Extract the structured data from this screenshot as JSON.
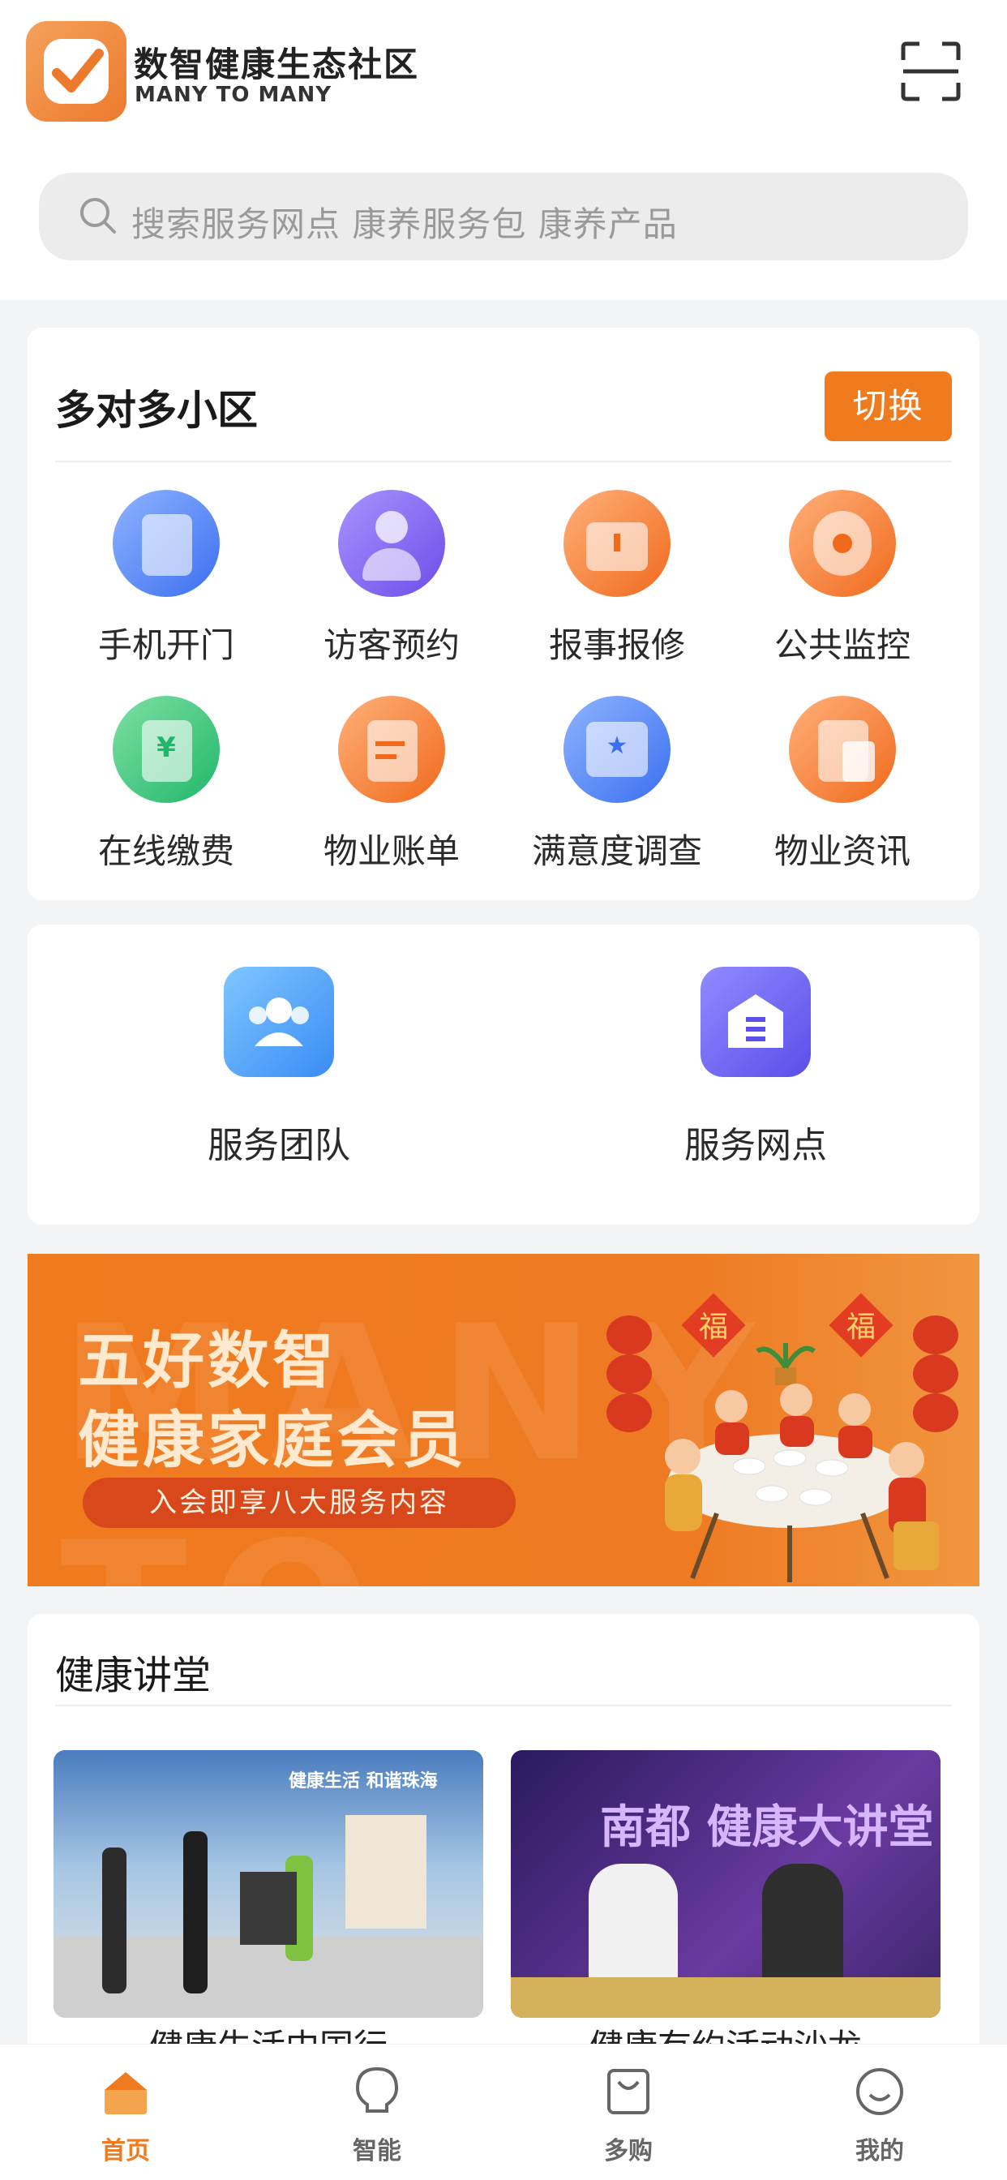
{
  "header": {
    "brand_cn": "数智健康生态社区",
    "brand_en": "MANY TO MANY"
  },
  "search": {
    "placeholder": "搜索服务网点 康养服务包 康养产品"
  },
  "community": {
    "title": "多对多小区",
    "switch_label": "切换",
    "items": [
      {
        "label": "手机开门",
        "icon": "door-icon",
        "color": "blue"
      },
      {
        "label": "访客预约",
        "icon": "visitor-icon",
        "color": "purple"
      },
      {
        "label": "报事报修",
        "icon": "toolbox-icon",
        "color": "orange"
      },
      {
        "label": "公共监控",
        "icon": "camera-icon",
        "color": "orange"
      },
      {
        "label": "在线缴费",
        "icon": "payment-icon",
        "color": "green"
      },
      {
        "label": "物业账单",
        "icon": "bill-icon",
        "color": "orange"
      },
      {
        "label": "满意度调查",
        "icon": "survey-icon",
        "color": "blue"
      },
      {
        "label": "物业资讯",
        "icon": "news-icon",
        "color": "orange"
      }
    ]
  },
  "services": {
    "items": [
      {
        "label": "服务团队",
        "icon": "team-icon"
      },
      {
        "label": "服务网点",
        "icon": "store-icon"
      }
    ]
  },
  "banner": {
    "line1": "五好数智",
    "line2": "健康家庭会员",
    "pill": "入会即享八大服务内容",
    "watermark": "MANY TO MANY",
    "art_text_1": "福",
    "art_text_2": "福"
  },
  "lecture": {
    "title": "健康讲堂",
    "videos": [
      {
        "caption": "健康生活中国行",
        "overlay": "健康生活 和谐珠海"
      },
      {
        "caption": "健康有约活动沙龙",
        "overlay": "南都 健康大讲堂"
      }
    ]
  },
  "tabbar": {
    "tabs": [
      {
        "label": "首页",
        "icon": "home-icon",
        "active": true
      },
      {
        "label": "智能",
        "icon": "bulb-icon",
        "active": false
      },
      {
        "label": "多购",
        "icon": "bag-icon",
        "active": false
      },
      {
        "label": "我的",
        "icon": "smile-icon",
        "active": false
      }
    ]
  },
  "colors": {
    "accent": "#f07a1e",
    "background": "#f3f4f6"
  }
}
